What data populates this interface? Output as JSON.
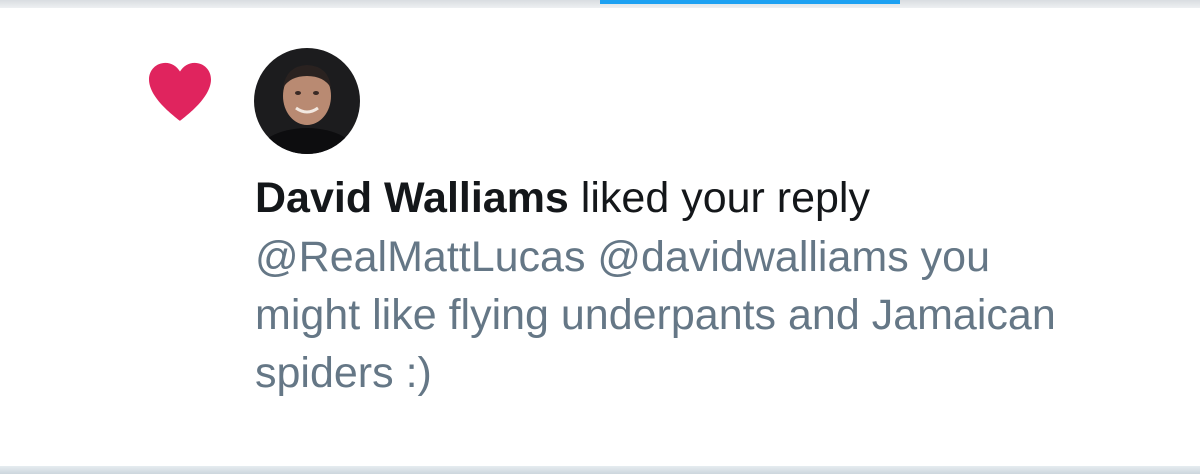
{
  "notification": {
    "user_name": "David Walliams",
    "action_text": " liked your reply",
    "tweet_text": "@RealMattLucas @davidwalliams you might like flying underpants and Jamaican spiders :)",
    "icon": "heart-icon",
    "accent_color": "#e0245e"
  },
  "colors": {
    "tab_indicator": "#1da1f2",
    "tweet_text": "#657786",
    "name_text": "#14171a"
  }
}
